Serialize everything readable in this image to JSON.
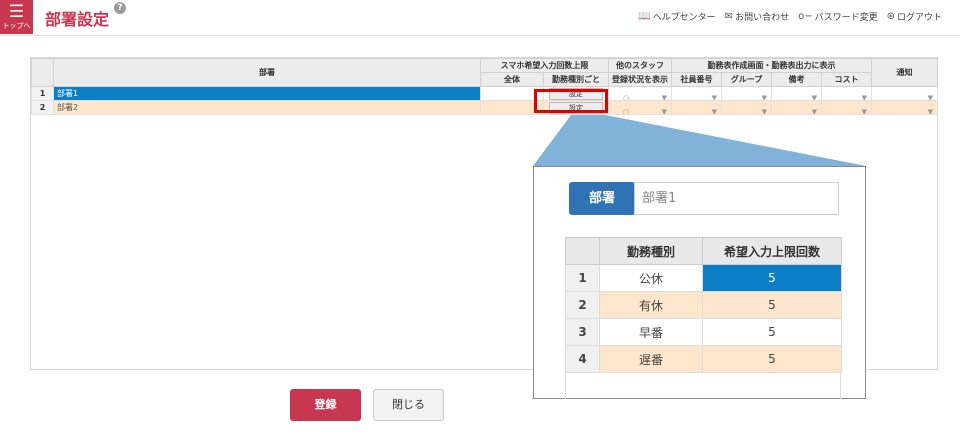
{
  "header": {
    "menu_label": "トップへ",
    "title": "部署設定",
    "help": "?",
    "links": [
      {
        "label": "ヘルプセンター",
        "icon": "book-icon"
      },
      {
        "label": "お問い合わせ",
        "icon": "mail-icon"
      },
      {
        "label": "パスワード変更",
        "icon": "key-icon"
      },
      {
        "label": "ログアウト",
        "icon": "lock-icon"
      }
    ]
  },
  "table": {
    "headers": {
      "dept": "部署",
      "smartphone_group": "スマホ希望入力回数上限",
      "overall": "全体",
      "per_type": "勤務種別ごと",
      "other_staff_1": "他のスタッフ",
      "other_staff_2": "登録状況を表示",
      "display_group": "勤務表作成画面・勤務表出力に表示",
      "emp_no": "社員番号",
      "group": "グループ",
      "notes": "備考",
      "cost": "コスト",
      "notice": "通知"
    },
    "rows": [
      {
        "num": "1",
        "dept": "部署1",
        "btn": "設定",
        "circle": "○"
      },
      {
        "num": "2",
        "dept": "部署2",
        "btn": "設定",
        "circle": "○"
      }
    ]
  },
  "zoom": {
    "dept_label": "部署",
    "dept_value": "部署1",
    "headers": [
      "勤務種別",
      "希望入力上限回数"
    ],
    "rows": [
      {
        "num": "1",
        "type": "公休",
        "limit": "5"
      },
      {
        "num": "2",
        "type": "有休",
        "limit": "5"
      },
      {
        "num": "3",
        "type": "早番",
        "limit": "5"
      },
      {
        "num": "4",
        "type": "遅番",
        "limit": "5"
      }
    ]
  },
  "buttons": {
    "register": "登録",
    "close": "閉じる"
  },
  "colors": {
    "brand": "#c7374f",
    "selected": "#0b7ec5",
    "alt_row": "#fde6cc",
    "dept_label": "#2e74b5",
    "highlight": "#e00000"
  }
}
